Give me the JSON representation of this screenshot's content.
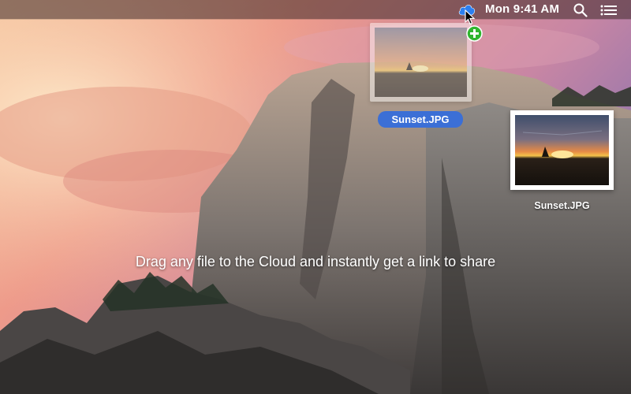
{
  "menubar": {
    "app_icon": "cloud-icon",
    "clock": "Mon 9:41 AM",
    "search_icon": "search-icon",
    "list_icon": "list-icon"
  },
  "drag": {
    "file_label": "Sunset.JPG",
    "badge_icon": "plus-circle-icon",
    "badge_color": "#2fb52f",
    "label_color": "#3b6fd6"
  },
  "desktop_file": {
    "label": "Sunset.JPG"
  },
  "caption": "Drag any file to the Cloud and instantly get a link to share",
  "colors": {
    "cloud": "#2b7ff0"
  }
}
